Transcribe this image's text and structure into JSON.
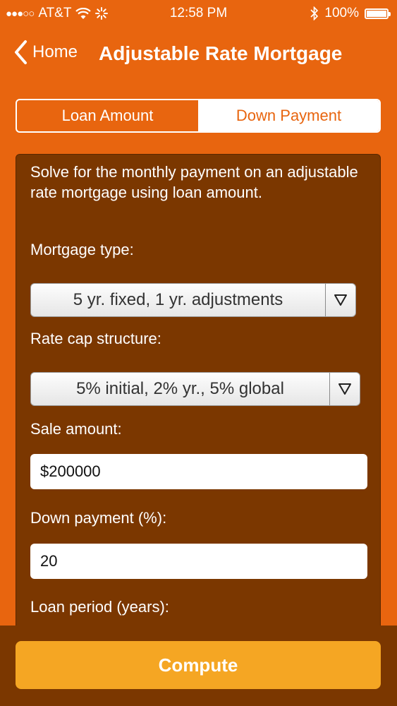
{
  "status_bar": {
    "carrier": "AT&T",
    "time": "12:58 PM",
    "battery": "100%"
  },
  "nav": {
    "back_label": "Home",
    "title": "Adjustable Rate Mortgage"
  },
  "segmented": {
    "options": [
      "Loan Amount",
      "Down Payment"
    ],
    "selected": "Loan Amount"
  },
  "form": {
    "description": "Solve for the monthly payment on an adjustable rate mortgage using loan amount.",
    "mortgage_type_label": "Mortgage type:",
    "mortgage_type_value": "5 yr. fixed, 1 yr. adjustments",
    "rate_cap_label": "Rate cap structure:",
    "rate_cap_value": "5% initial, 2% yr., 5% global",
    "sale_amount_label": "Sale amount:",
    "sale_amount_value": "$200000",
    "down_payment_label": "Down payment (%):",
    "down_payment_value": "20",
    "loan_period_label": "Loan period (years):"
  },
  "compute_label": "Compute",
  "colors": {
    "background": "#e8650f",
    "panel": "#7b3700",
    "compute_button": "#f5a623"
  }
}
